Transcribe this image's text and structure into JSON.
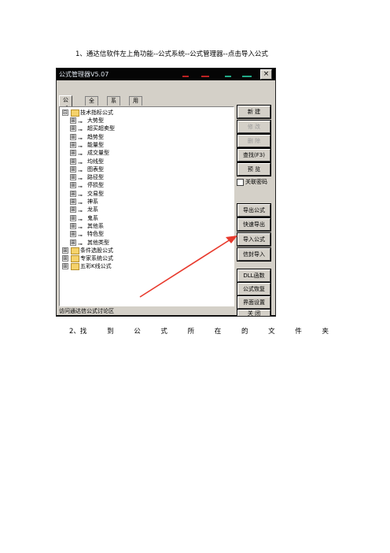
{
  "steps": {
    "step1": "1、通达信软件左上角功能--公式系统--公式管理器--点击导入公式",
    "step2_chars": [
      "2、找",
      "到",
      "公",
      "式",
      "所",
      "在",
      "的",
      "文",
      "件",
      "夹"
    ]
  },
  "window": {
    "title": "公式管理器V5.07",
    "close_glyph": "×",
    "tabs": [
      "公式组",
      "全部",
      "系统",
      "用户"
    ],
    "status": "访问通达信公式讨论区"
  },
  "tree": {
    "root": {
      "expander": "⊟",
      "label": "技术指标公式"
    },
    "children": [
      "大势型",
      "超买超卖型",
      "趋势型",
      "能量型",
      "成交量型",
      "均线型",
      "图表型",
      "路径型",
      "停损型",
      "交易型",
      "神系",
      "龙系",
      "鬼系",
      "其他系",
      "特色型",
      "其他类型"
    ],
    "child_expander": "⊞",
    "child_bullet": "⊸",
    "others": [
      {
        "expander": "⊞",
        "label": "条件选股公式"
      },
      {
        "expander": "⊞",
        "label": "专家系统公式"
      },
      {
        "expander": "⊞",
        "label": "五彩K线公式"
      }
    ]
  },
  "buttons": {
    "new": "新 建",
    "modify": "修 改",
    "delete": "删 除",
    "find": "查找(F3)",
    "preview": "预 览",
    "lock_checkbox": "关联密码",
    "export": "导出公式",
    "quick_export": "快速导出",
    "import": "导入公式",
    "trust_import": "信封导入",
    "dll": "DLL函数",
    "formula_change": "公式恢复",
    "interface": "界面设置",
    "close": "关 闭"
  },
  "colors": {
    "window_bg": "#d4d0c8",
    "titlebar": "#050505",
    "arrow": "#e8392c",
    "folder": "#f5d26a"
  }
}
